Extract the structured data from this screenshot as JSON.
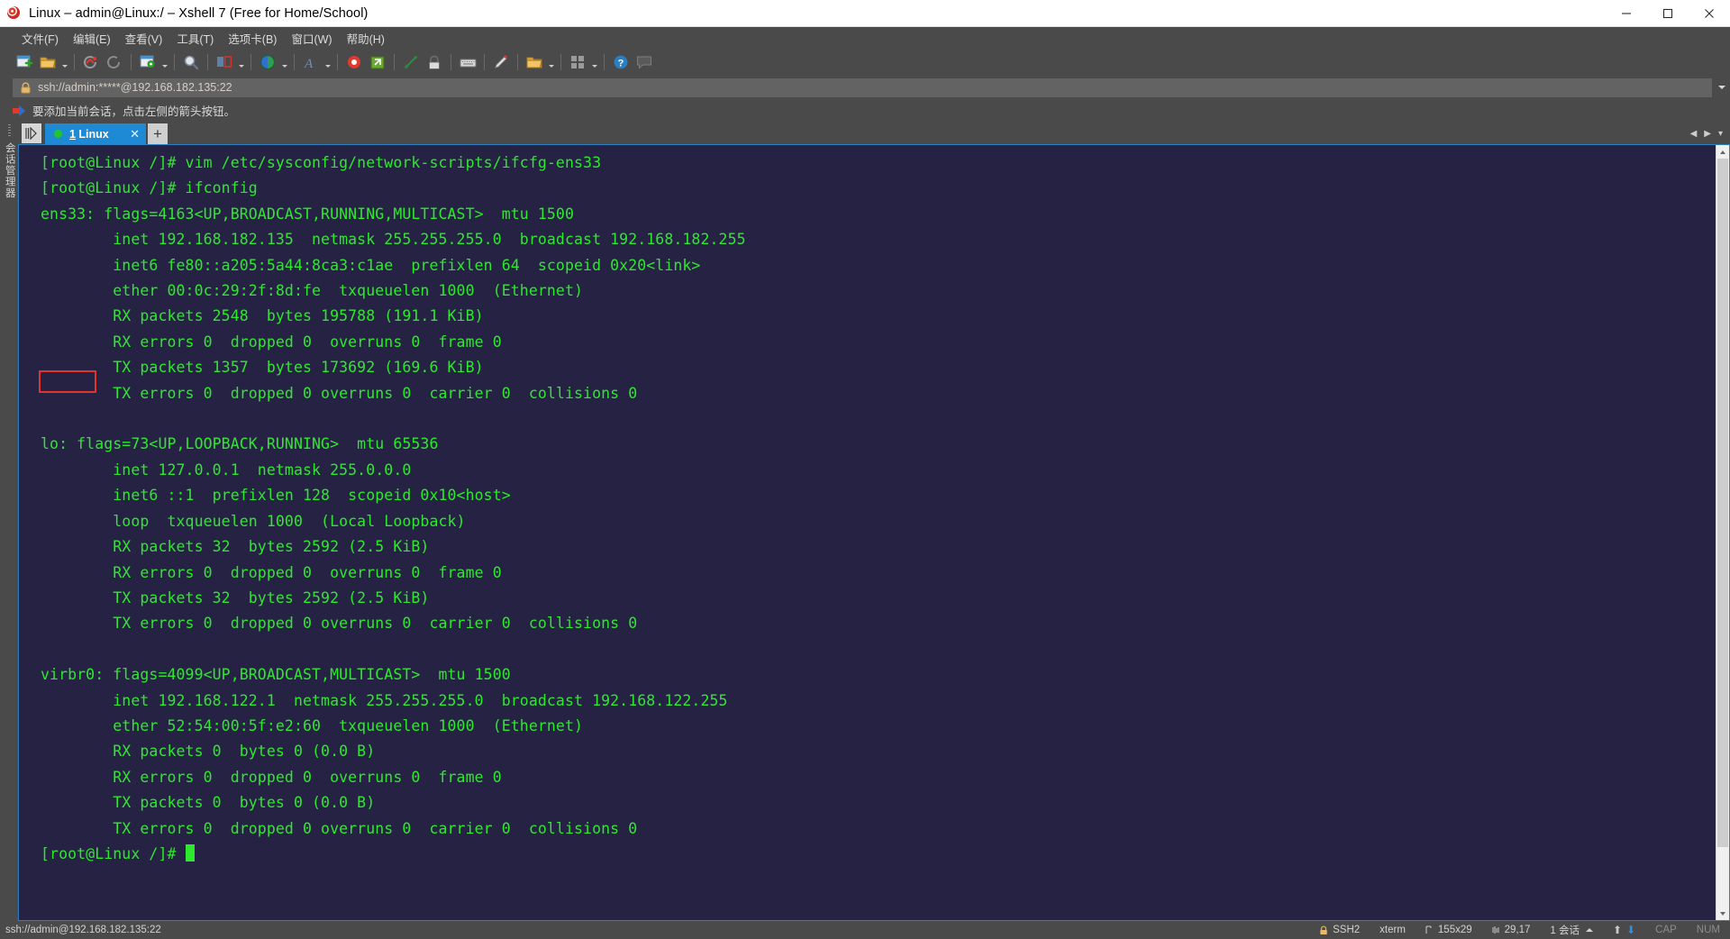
{
  "window": {
    "title": "Linux – admin@Linux:/ – Xshell 7 (Free for Home/School)",
    "icon": "xshell-logo-icon",
    "minimize": "–",
    "maximize": "▢",
    "close": "✕"
  },
  "menu": {
    "items": [
      {
        "label": "文件(F)",
        "name": "menu-file"
      },
      {
        "label": "编辑(E)",
        "name": "menu-edit"
      },
      {
        "label": "查看(V)",
        "name": "menu-view"
      },
      {
        "label": "工具(T)",
        "name": "menu-tools"
      },
      {
        "label": "选项卡(B)",
        "name": "menu-tabs"
      },
      {
        "label": "窗口(W)",
        "name": "menu-window"
      },
      {
        "label": "帮助(H)",
        "name": "menu-help"
      }
    ]
  },
  "toolbar": {
    "buttons": [
      "new-session-icon",
      "open-folder-icon",
      "reconnect-icon",
      "disconnect-icon",
      "session-properties-icon",
      "find-icon",
      "layout-icon",
      "globe-icon",
      "font-icon",
      "record-icon",
      "log-icon",
      "fullscreen-icon",
      "lock-icon",
      "keyboard-icon",
      "highlight-icon",
      "transfer-icon",
      "apps-icon",
      "help-icon",
      "chat-icon"
    ]
  },
  "address": {
    "icon": "lock-icon",
    "value": "ssh://admin:*****@192.168.182.135:22",
    "placeholder": "ssh://",
    "dropdown": "chevron-down-icon"
  },
  "notice": {
    "icon": "arrow-right-icon",
    "text": "要添加当前会话，点击左侧的箭头按钮。"
  },
  "sidebar": {
    "label": "会话管理器"
  },
  "tabs": {
    "strip_icon": "tab-list-icon",
    "items": [
      {
        "label_number": "1",
        "label": " Linux",
        "status": "connected",
        "close": "✕"
      }
    ],
    "add": "+",
    "nav_prev": "◀",
    "nav_next": "▶",
    "nav_menu": "▾"
  },
  "terminal": {
    "colors": {
      "background": "#262244",
      "foreground": "#2ee82e",
      "highlight": "#e2342c"
    },
    "highlight_target": "ens33:",
    "lines": [
      "[root@Linux /]# vim /etc/sysconfig/network-scripts/ifcfg-ens33",
      "[root@Linux /]# ifconfig",
      "ens33: flags=4163<UP,BROADCAST,RUNNING,MULTICAST>  mtu 1500",
      "        inet 192.168.182.135  netmask 255.255.255.0  broadcast 192.168.182.255",
      "        inet6 fe80::a205:5a44:8ca3:c1ae  prefixlen 64  scopeid 0x20<link>",
      "        ether 00:0c:29:2f:8d:fe  txqueuelen 1000  (Ethernet)",
      "        RX packets 2548  bytes 195788 (191.1 KiB)",
      "        RX errors 0  dropped 0  overruns 0  frame 0",
      "        TX packets 1357  bytes 173692 (169.6 KiB)",
      "        TX errors 0  dropped 0 overruns 0  carrier 0  collisions 0",
      "",
      "lo: flags=73<UP,LOOPBACK,RUNNING>  mtu 65536",
      "        inet 127.0.0.1  netmask 255.0.0.0",
      "        inet6 ::1  prefixlen 128  scopeid 0x10<host>",
      "        loop  txqueuelen 1000  (Local Loopback)",
      "        RX packets 32  bytes 2592 (2.5 KiB)",
      "        RX errors 0  dropped 0  overruns 0  frame 0",
      "        TX packets 32  bytes 2592 (2.5 KiB)",
      "        TX errors 0  dropped 0 overruns 0  carrier 0  collisions 0",
      "",
      "virbr0: flags=4099<UP,BROADCAST,MULTICAST>  mtu 1500",
      "        inet 192.168.122.1  netmask 255.255.255.0  broadcast 192.168.122.255",
      "        ether 52:54:00:5f:e2:60  txqueuelen 1000  (Ethernet)",
      "        RX packets 0  bytes 0 (0.0 B)",
      "        RX errors 0  dropped 0  overruns 0  frame 0",
      "        TX packets 0  bytes 0 (0.0 B)",
      "        TX errors 0  dropped 0 overruns 0  carrier 0  collisions 0",
      ""
    ],
    "prompt": "[root@Linux /]# "
  },
  "status": {
    "connection": "ssh://admin@192.168.182.135:22",
    "protocol": "SSH2",
    "terminal_type": "xterm",
    "size": "155x29",
    "cursor": "29,17",
    "sessions": "1 会话",
    "cap": "CAP",
    "num": "NUM"
  }
}
